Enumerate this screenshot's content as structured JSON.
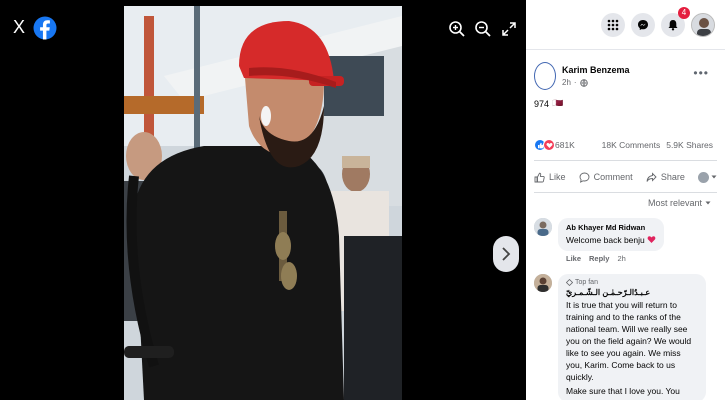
{
  "brand": {
    "accent": "#1877f2"
  },
  "viewer": {
    "close_label": "X",
    "tools": [
      "zoom-in-icon",
      "zoom-out-icon",
      "fullscreen-icon"
    ]
  },
  "topbar": {
    "notification_count": "4"
  },
  "post": {
    "author": "Karim Benzema",
    "time": "2h",
    "text": "974",
    "flag": "🇶🇦",
    "reactions_count": "681K",
    "comments": "18K Comments",
    "shares": "5.9K Shares"
  },
  "actions": {
    "like": "Like",
    "comment": "Comment",
    "share": "Share"
  },
  "sort": {
    "label": "Most relevant"
  },
  "comments": [
    {
      "author": "Ab Khayer Md Ridwan",
      "text": "Welcome back benju",
      "like": "Like",
      "reply": "Reply",
      "time": "2h"
    },
    {
      "badge": "Top fan",
      "author": "عـبـدُالـرّحـمٰـن الـشّـمـريّ",
      "text": "It is true that you will return to training and to the ranks of the national team. Will we really see you on the field again? We would like to see you again. We miss you, Karim. Come back to us quickly.",
      "overflow": "Make sure that I love you. You"
    }
  ]
}
